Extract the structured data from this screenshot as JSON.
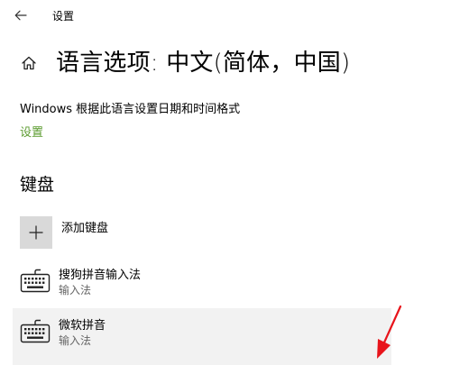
{
  "window": {
    "title": "设置",
    "back_icon": "back-arrow-icon"
  },
  "header": {
    "home_icon": "home-icon",
    "title": "语言选项: 中文(简体，中国)"
  },
  "region": {
    "description": "Windows 根据此语言设置日期和时间格式",
    "settings_link": "设置"
  },
  "keyboards": {
    "heading": "键盘",
    "add_label": "添加键盘",
    "add_icon": "plus-icon",
    "items": [
      {
        "name": "搜狗拼音输入法",
        "type": "输入法",
        "icon": "keyboard-icon",
        "selected": false
      },
      {
        "name": "微软拼音",
        "type": "输入法",
        "icon": "keyboard-icon",
        "selected": true
      }
    ]
  },
  "colors": {
    "link": "#5b9b2f",
    "selected_row": "#f2f2f2",
    "add_tile": "#d9d9d9",
    "annotation": "#e8141b"
  }
}
